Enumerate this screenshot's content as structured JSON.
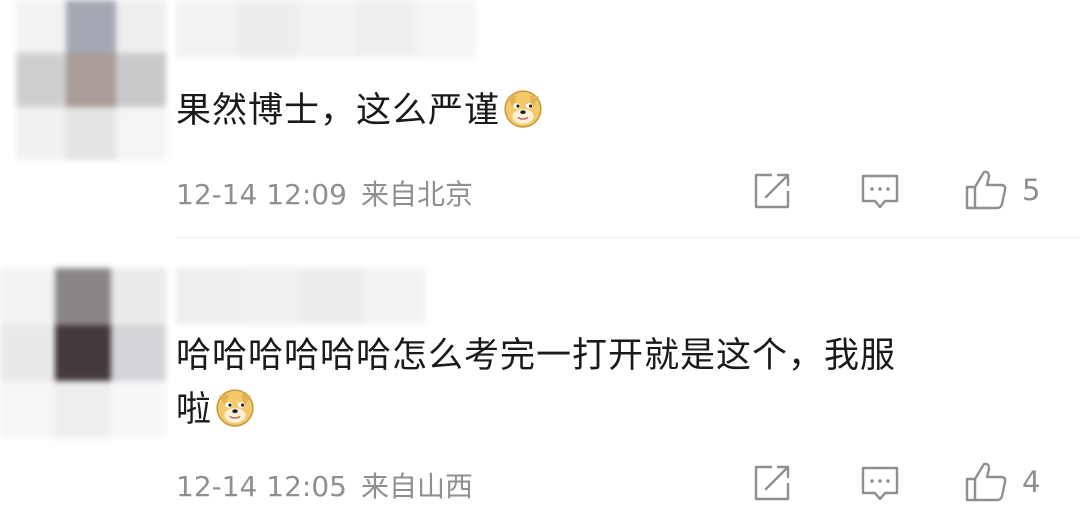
{
  "comments": [
    {
      "text": "果然博士，这么严谨",
      "emoji": "doge-emoji",
      "time": "12-14 12:09",
      "location": "来自北京",
      "likes": "5"
    },
    {
      "text_line1": "哈哈哈哈哈哈怎么考完一打开就是这个，我服",
      "text_line2": "啦",
      "emoji": "doge-emoji",
      "time": "12-14 12:05",
      "location": "来自山西",
      "likes": "4"
    }
  ],
  "icons": {
    "share": "share-icon",
    "reply": "reply-icon",
    "like": "thumbs-up-icon"
  },
  "colors": {
    "text": "#1a1a1a",
    "meta": "#8f8f8f",
    "divider": "#ececec"
  }
}
